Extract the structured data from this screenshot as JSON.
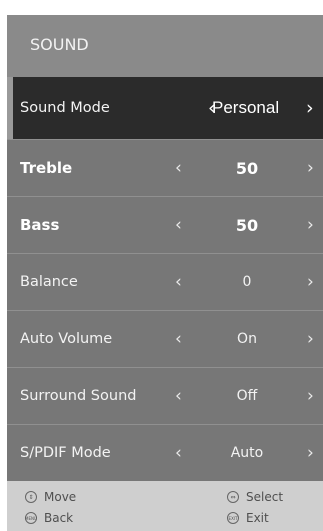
{
  "menu": {
    "title": "SOUND",
    "items": [
      {
        "label": "Sound Mode",
        "value": "Personal"
      },
      {
        "label": "Treble",
        "value": "50"
      },
      {
        "label": "Bass",
        "value": "50"
      },
      {
        "label": "Balance",
        "value": "0"
      },
      {
        "label": "Auto Volume",
        "value": "On"
      },
      {
        "label": "Surround Sound",
        "value": "Off"
      },
      {
        "label": "S/PDIF Mode",
        "value": "Auto"
      }
    ]
  },
  "footer": {
    "move": "Move",
    "select": "Select",
    "back": "Back",
    "exit": "Exit",
    "back_icon": "MENU",
    "exit_icon": "EXIT"
  },
  "icons": {
    "left": "chevron-left-icon",
    "right": "chevron-right-icon",
    "move": "updown-icon",
    "select": "leftright-icon"
  }
}
